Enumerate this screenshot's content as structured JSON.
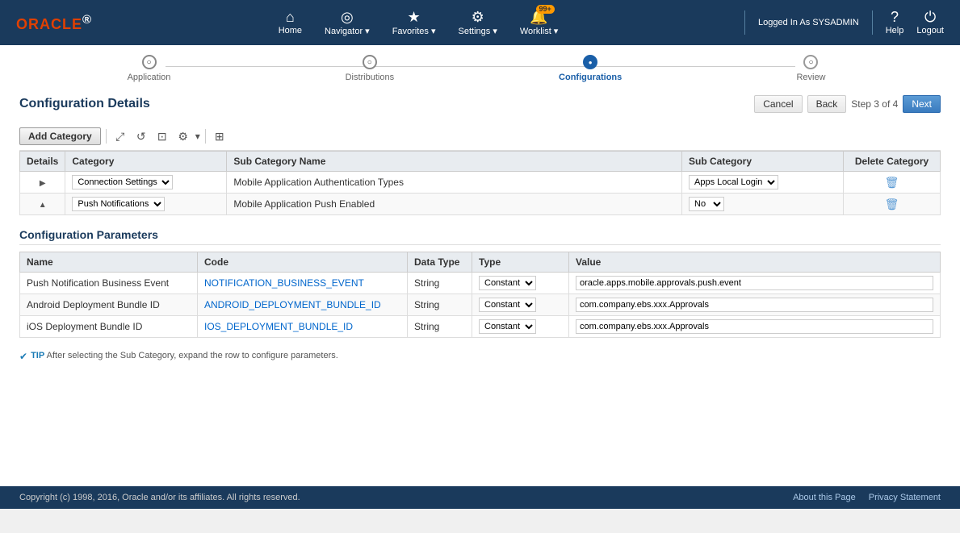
{
  "app": {
    "logo": "ORACLE",
    "logo_superscript": "®"
  },
  "header": {
    "nav_items": [
      {
        "id": "home",
        "icon": "⌂",
        "label": "Home"
      },
      {
        "id": "navigator",
        "icon": "⊙",
        "label": "Navigator ▾"
      },
      {
        "id": "favorites",
        "icon": "★",
        "label": "Favorites ▾"
      },
      {
        "id": "settings",
        "icon": "⚙",
        "label": "Settings ▾"
      },
      {
        "id": "worklist",
        "icon": "🔔",
        "label": "Worklist ▾",
        "badge": "99+"
      }
    ],
    "user_label": "Logged In As SYSADMIN",
    "help_label": "Help",
    "logout_label": "Logout"
  },
  "stepper": {
    "steps": [
      {
        "id": "application",
        "label": "Application",
        "state": "completed"
      },
      {
        "id": "distributions",
        "label": "Distributions",
        "state": "completed"
      },
      {
        "id": "configurations",
        "label": "Configurations",
        "state": "active"
      },
      {
        "id": "review",
        "label": "Review",
        "state": "pending"
      }
    ]
  },
  "page": {
    "title": "Configuration Details",
    "step_info": "Step 3 of 4",
    "cancel_label": "Cancel",
    "back_label": "Back",
    "next_label": "Next"
  },
  "toolbar": {
    "add_category_label": "Add Category"
  },
  "main_table": {
    "columns": [
      "Details",
      "Category",
      "Sub Category Name",
      "Sub Category",
      "Delete Category"
    ],
    "rows": [
      {
        "expanded": false,
        "category": "Connection Settings",
        "sub_category_name": "Mobile Application Authentication Types",
        "sub_category_value": "Apps Local Login"
      },
      {
        "expanded": true,
        "category": "Push Notifications",
        "sub_category_name": "Mobile Application Push Enabled",
        "sub_category_value": "No"
      }
    ]
  },
  "config_params": {
    "title": "Configuration Parameters",
    "columns": [
      "Name",
      "Code",
      "Data Type",
      "Type",
      "Value"
    ],
    "rows": [
      {
        "name": "Push Notification Business Event",
        "code": "NOTIFICATION_BUSINESS_EVENT",
        "data_type": "String",
        "type": "Constant",
        "value": "oracle.apps.mobile.approvals.push.event"
      },
      {
        "name": "Android Deployment Bundle ID",
        "code": "ANDROID_DEPLOYMENT_BUNDLE_ID",
        "data_type": "String",
        "type": "Constant",
        "value": "com.company.ebs.xxx.Approvals"
      },
      {
        "name": "iOS Deployment Bundle ID",
        "code": "IOS_DEPLOYMENT_BUNDLE_ID",
        "data_type": "String",
        "type": "Constant",
        "value": "com.company.ebs.xxx.Approvals"
      }
    ]
  },
  "tip": {
    "prefix": "TIP",
    "text": "After selecting the Sub Category, expand the row to configure parameters."
  },
  "footer": {
    "copyright": "Copyright (c) 1998, 2016, Oracle and/or its affiliates. All rights reserved.",
    "links": [
      "About this Page",
      "Privacy Statement"
    ]
  }
}
